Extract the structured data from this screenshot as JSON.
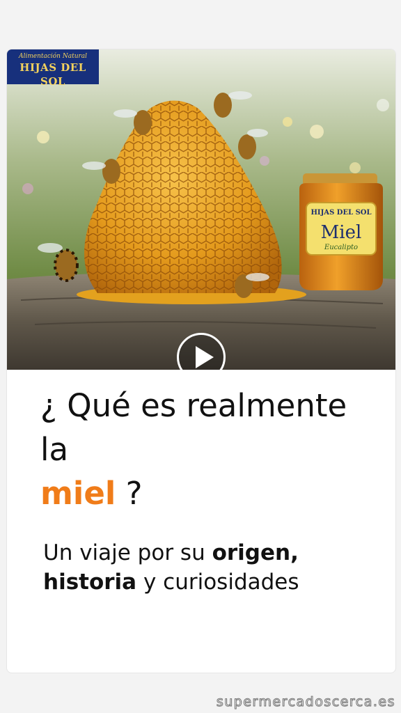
{
  "hero": {
    "brand_tagline": "Alimentación Natural",
    "brand_name": "HIJAS DEL SOL",
    "jar_brand": "HIJAS DEL SOL",
    "jar_label": "Miel",
    "jar_sublabel": "Eucalipto"
  },
  "video": {
    "play_icon": "play-icon"
  },
  "article": {
    "title_part1": "¿ Qué es realmente la",
    "title_accent": "miel",
    "title_end": " ?",
    "subtitle_part1": "Un viaje por su ",
    "subtitle_bold1": "origen,",
    "subtitle_bold2": "historia",
    "subtitle_part2": " y curiosidades"
  },
  "colors": {
    "accent": "#f07c19",
    "logo_bg": "#17307c",
    "logo_text": "#f3d25d"
  },
  "watermark": "supermercadoscerca.es"
}
